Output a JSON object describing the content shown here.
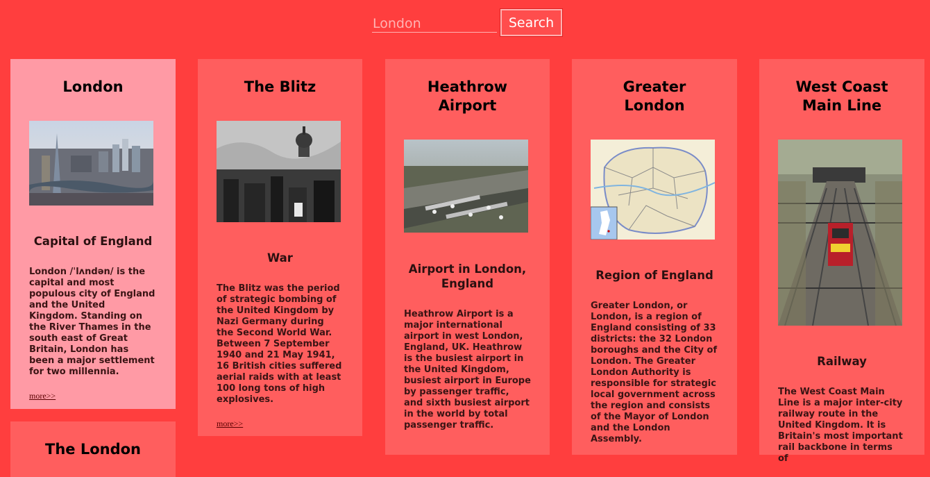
{
  "search": {
    "value": "",
    "placeholder": "London",
    "button_label": "Search"
  },
  "cards": [
    {
      "title": "London",
      "subtitle": "Capital of England",
      "description": "London /ˈlʌndən/ is the capital and most populous city of England and the United Kingdom. Standing on the River Thames in the south east of Great Britain, London has been a major settlement for two millennia.",
      "more": "more>>",
      "image": "london-skyline-photo"
    },
    {
      "title": "The Blitz",
      "subtitle": "War",
      "description": "The Blitz was the period of strategic bombing of the United Kingdom by Nazi Germany during the Second World War. Between 7 September 1940 and 21 May 1941, 16 British cities suffered aerial raids with at least 100 long tons of high explosives.",
      "more": "more>>",
      "image": "st-pauls-blitz-photo"
    },
    {
      "title": "Heathrow Airport",
      "subtitle": "Airport in London, England",
      "description": "Heathrow Airport is a major international airport in west London, England, UK. Heathrow is the busiest airport in the United Kingdom, busiest airport in Europe by passenger traffic, and sixth busiest airport in the world by total passenger traffic.",
      "image": "heathrow-aerial-photo"
    },
    {
      "title": "Greater London",
      "subtitle": "Region of England",
      "description": "Greater London, or London, is a region of England consisting of 33 districts: the 32 London boroughs and the City of London. The Greater London Authority is responsible for strategic local government across the region and consists of the Mayor of London and the London Assembly.",
      "image": "greater-london-map"
    },
    {
      "title": "West Coast Main Line",
      "subtitle": "Railway",
      "description": "The West Coast Main Line is a major inter-city railway route in the United Kingdom. It is Britain's most important rail backbone in terms of",
      "image": "railway-train-photo"
    },
    {
      "title": "The London"
    }
  ],
  "colors": {
    "page_background": "#ff3e3e",
    "card_background": "#ff5e5e",
    "active_card_background": "#ff9aa5"
  }
}
